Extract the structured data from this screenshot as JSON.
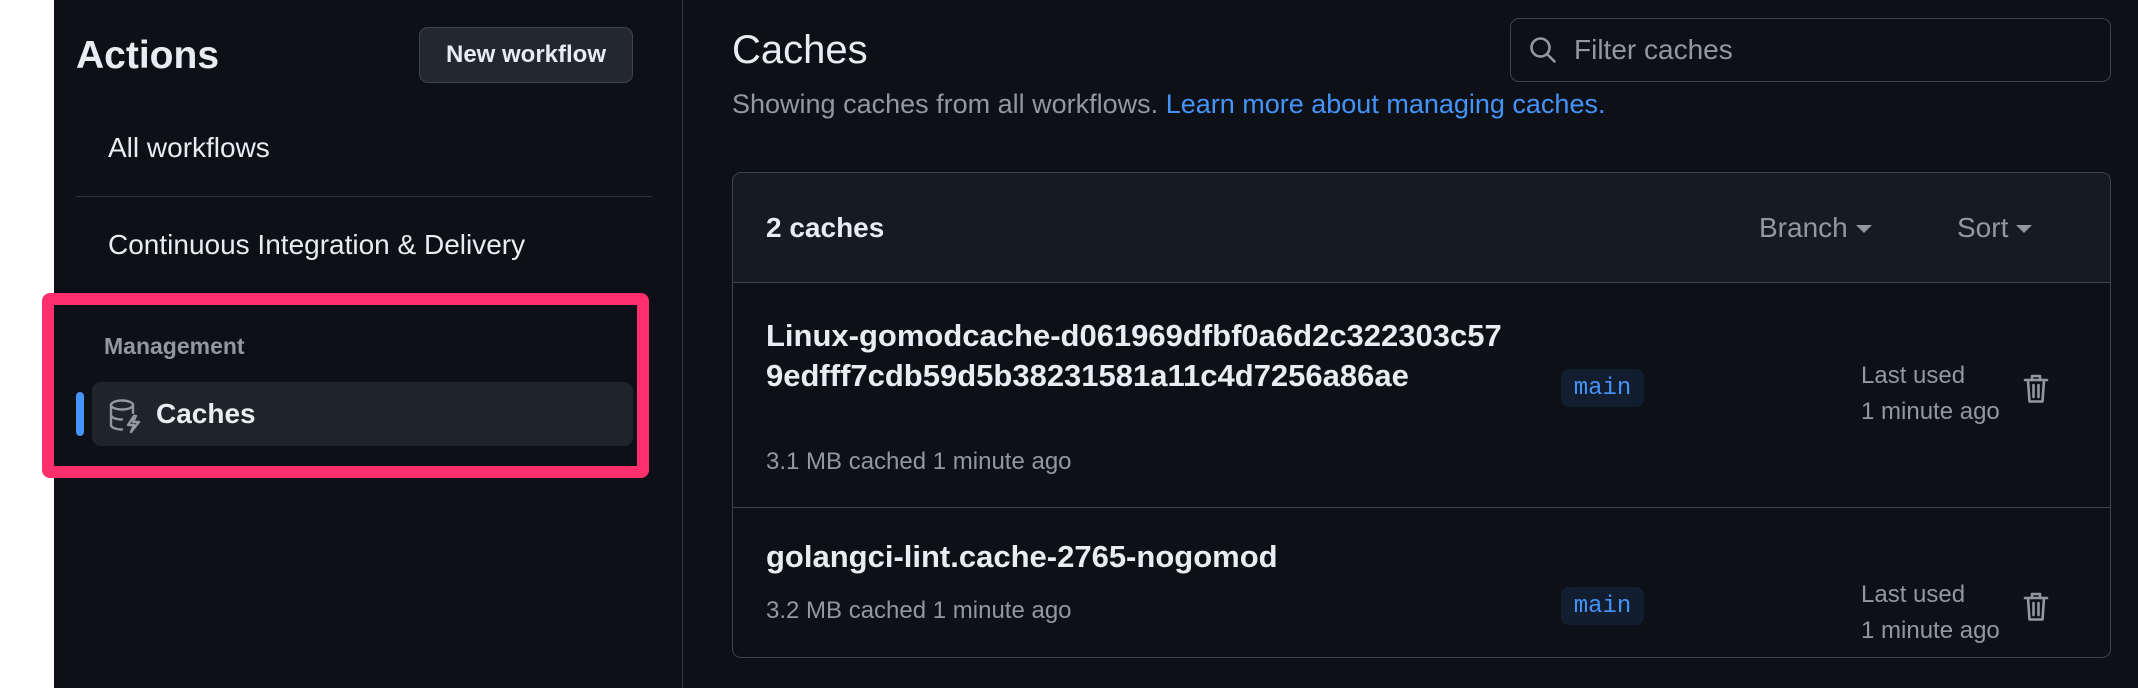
{
  "sidebar": {
    "title": "Actions",
    "new_workflow_label": "New workflow",
    "items": [
      {
        "label": "All workflows"
      },
      {
        "label": "Continuous Integration & Delivery"
      }
    ],
    "management": {
      "heading": "Management",
      "caches_label": "Caches",
      "caches_icon": "database-icon"
    }
  },
  "main": {
    "title": "Caches",
    "subtitle": "Showing caches from all workflows.",
    "subtitle_link": "Learn more about managing caches.",
    "filter": {
      "placeholder": "Filter caches",
      "value": ""
    },
    "list": {
      "count_label": "2 caches",
      "branch_label": "Branch",
      "sort_label": "Sort",
      "caches": [
        {
          "name": "Linux-gomodcache-d061969dfbf0a6d2c322303c579edfff7cdb59d5b38231581a11c4d7256a86ae",
          "meta": "3.1 MB cached 1 minute ago",
          "branch": "main",
          "last_used_label": "Last used",
          "last_used_value": "1 minute ago"
        },
        {
          "name": "golangci-lint.cache-2765-nogomod",
          "meta": "3.2 MB cached 1 minute ago",
          "branch": "main",
          "last_used_label": "Last used",
          "last_used_value": "1 minute ago"
        }
      ]
    }
  },
  "colors": {
    "background": "#0d1117",
    "accent": "#4493f8",
    "highlight": "#ff2f6d"
  }
}
